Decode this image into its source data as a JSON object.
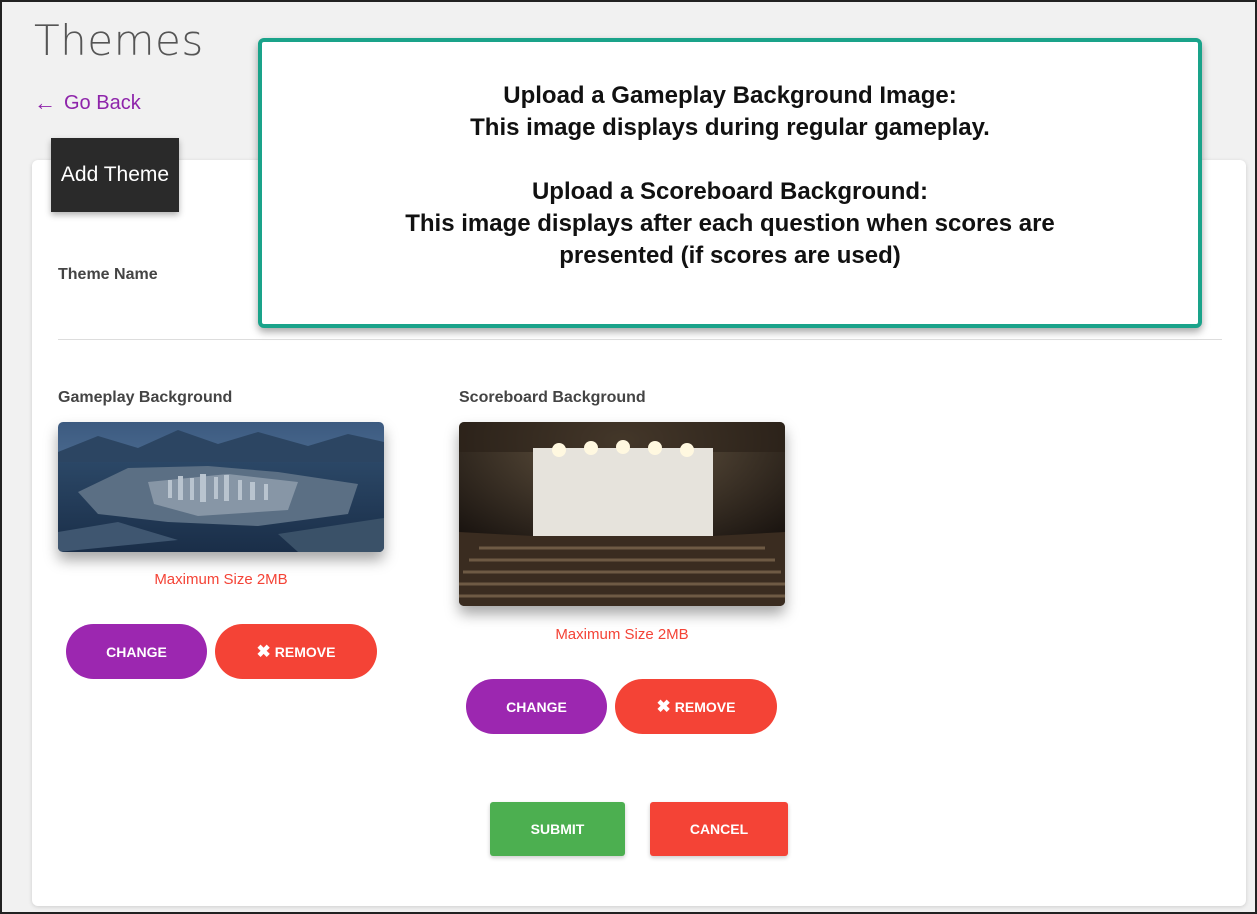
{
  "page": {
    "title": "Themes",
    "go_back": "Go Back"
  },
  "card": {
    "header": "Add Theme",
    "theme_name_label": "Theme Name"
  },
  "gameplay": {
    "label": "Gameplay Background",
    "max_size": "Maximum Size 2MB",
    "change_label": "CHANGE",
    "remove_label": "REMOVE"
  },
  "scoreboard": {
    "label": "Scoreboard Background",
    "max_size": "Maximum Size 2MB",
    "change_label": "CHANGE",
    "remove_label": "REMOVE"
  },
  "actions": {
    "submit_label": "SUBMIT",
    "cancel_label": "CANCEL"
  },
  "callout": {
    "line1": "Upload a Gameplay Background Image:",
    "line2": "This image displays during regular gameplay.",
    "line3": "Upload a Scoreboard Background:",
    "line4": "This image displays after each question when scores are",
    "line5": "presented (if scores are used)"
  },
  "icons": {
    "back": "arrow-left-icon",
    "remove": "x-icon"
  },
  "colors": {
    "accent_purple": "#9c27b0",
    "danger_red": "#f44336",
    "success_green": "#4caf50",
    "callout_border": "#1aa38a"
  }
}
